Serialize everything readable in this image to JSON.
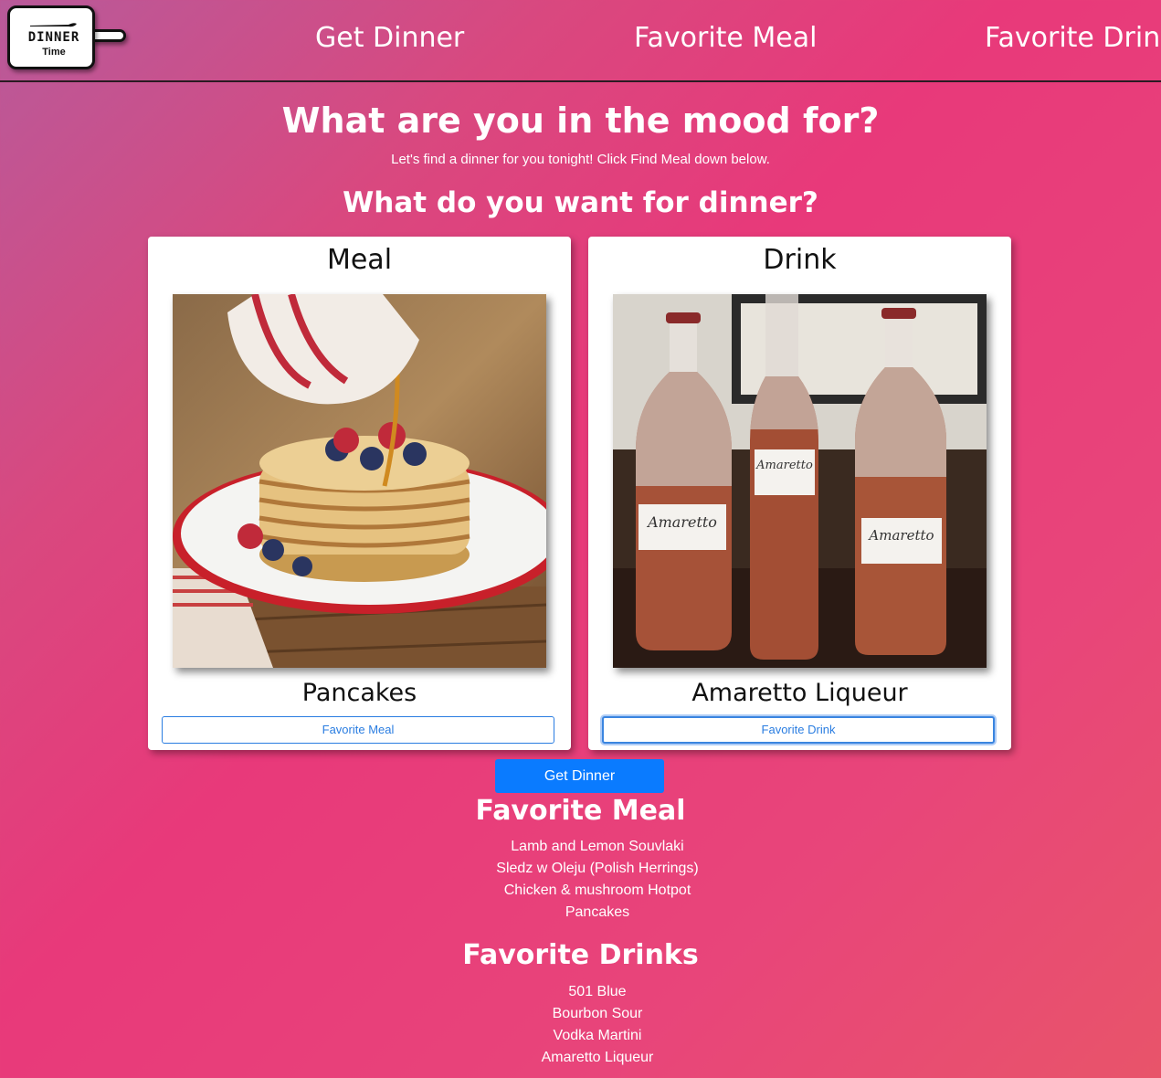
{
  "navbar": {
    "logo_text": "DINNER",
    "logo_subtext": "Time",
    "links": [
      "Get Dinner",
      "Favorite Meal",
      "Favorite Drink"
    ]
  },
  "hero": {
    "title": "What are you in the mood for?",
    "subtitle": "Let's find a dinner for you tonight! Click Find Meal down below."
  },
  "question": "What do you want for dinner?",
  "meal_card": {
    "header": "Meal",
    "name": "Pancakes",
    "button": "Favorite Meal"
  },
  "drink_card": {
    "header": "Drink",
    "name": "Amaretto Liqueur",
    "button": "Favorite Drink",
    "label_on_bottles": "Amaretto"
  },
  "get_dinner_button": "Get Dinner",
  "favorite_meals": {
    "title": "Favorite Meal",
    "items": [
      "Lamb and Lemon Souvlaki",
      "Sledz w Oleju (Polish Herrings)",
      "Chicken & mushroom Hotpot",
      "Pancakes"
    ]
  },
  "favorite_drinks": {
    "title": "Favorite Drinks",
    "items": [
      "501 Blue",
      "Bourbon Sour",
      "Vodka Martini",
      "Amaretto Liqueur"
    ]
  },
  "colors": {
    "accent": "#0a7bff",
    "outline_button": "#2a7de1",
    "gradient_start": "#b85a9a",
    "gradient_mid": "#e8397a",
    "gradient_end": "#e8546a"
  }
}
